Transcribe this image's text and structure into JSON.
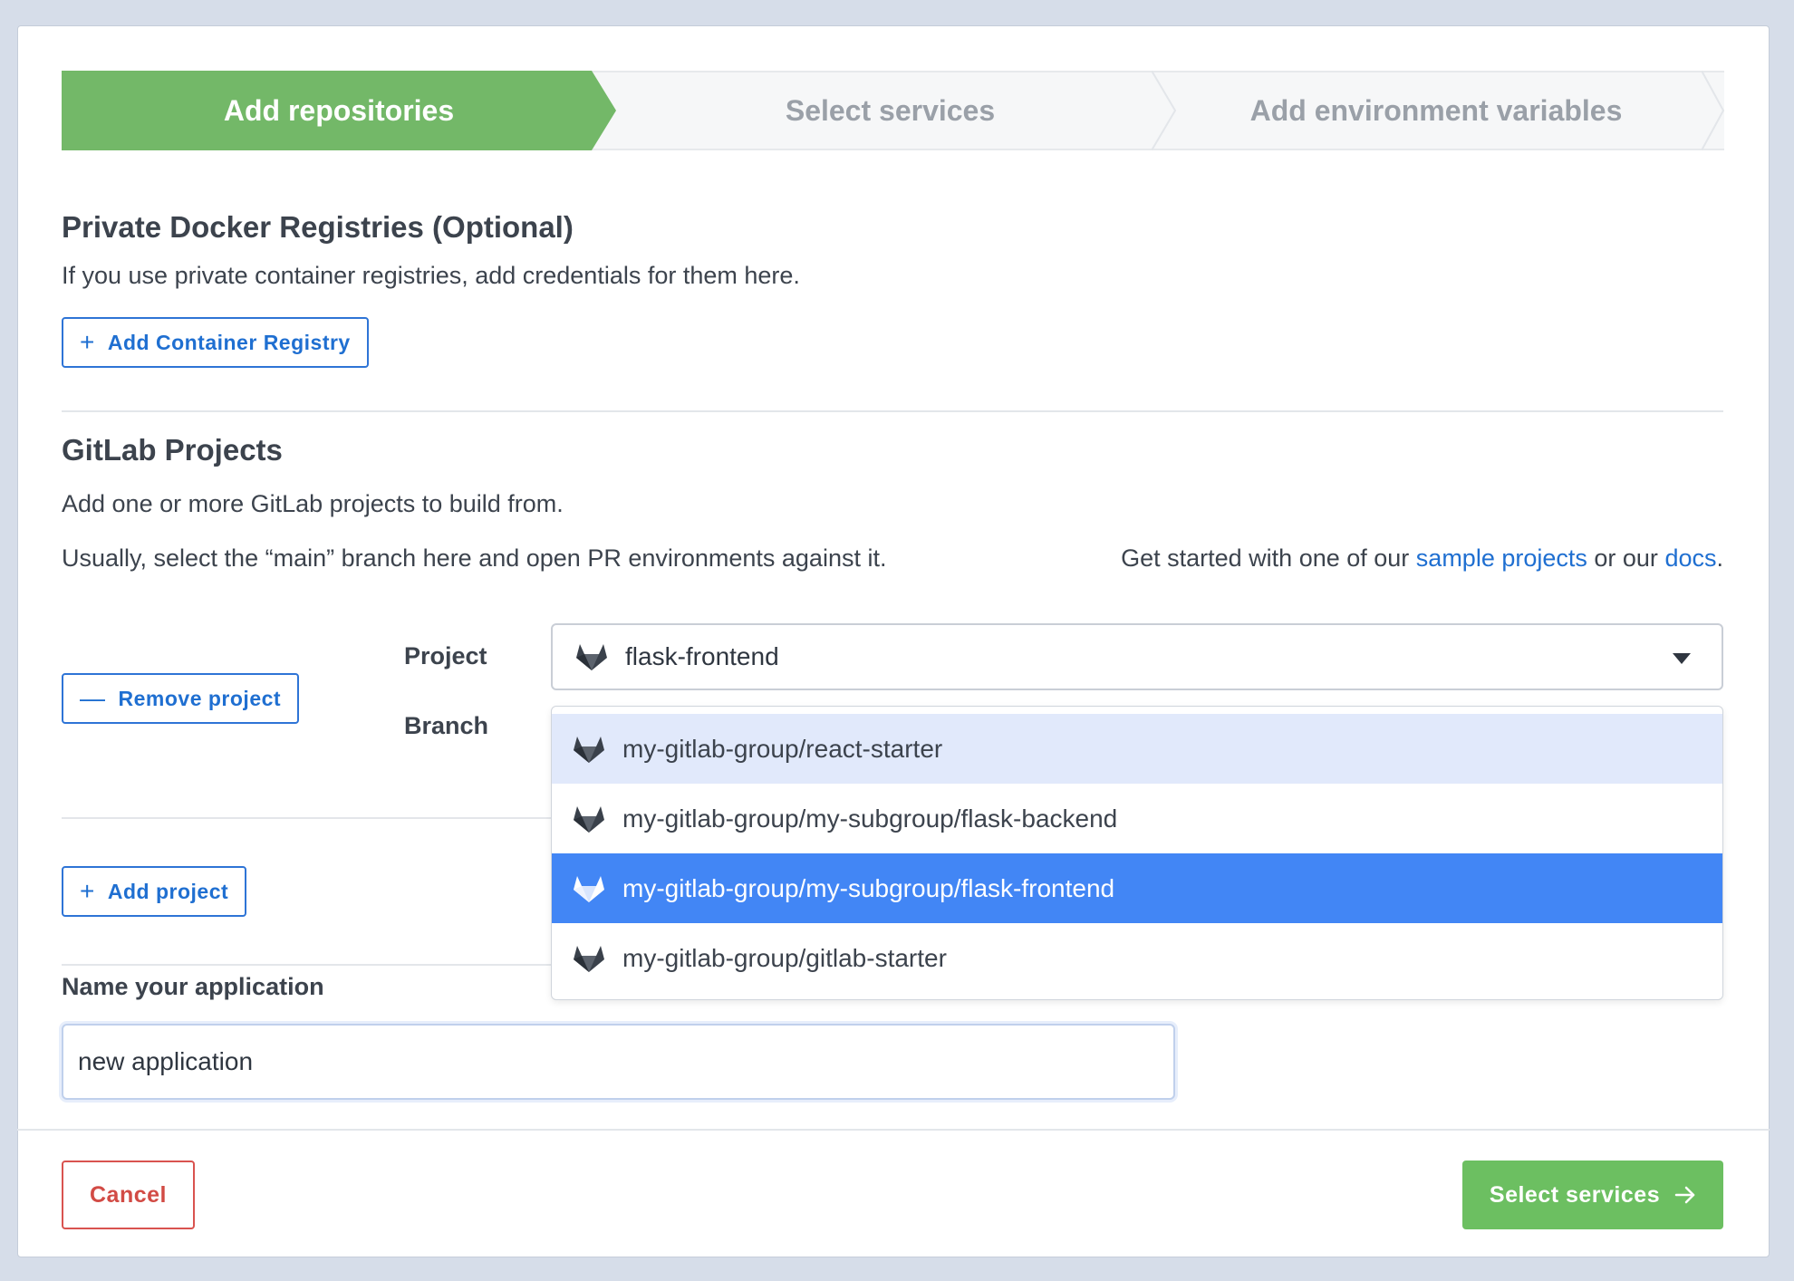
{
  "stepper": {
    "steps": [
      {
        "label": "Add repositories",
        "state": "active"
      },
      {
        "label": "Select services",
        "state": "inactive"
      },
      {
        "label": "Add environment variables",
        "state": "inactive"
      }
    ]
  },
  "registries": {
    "title": "Private Docker Registries (Optional)",
    "description": "If you use private container registries, add credentials for them here.",
    "add_button": "Add Container Registry"
  },
  "projects": {
    "title": "GitLab Projects",
    "description": "Add one or more GitLab projects to build from.",
    "hint": "Usually, select the “main” branch here and open PR environments against it.",
    "get_started_prefix": "Get started with one of our ",
    "sample_link": "sample projects",
    "get_started_middle": " or our ",
    "docs_link": "docs",
    "get_started_suffix": ".",
    "remove_button": "Remove project",
    "project_label": "Project",
    "branch_label": "Branch",
    "selected_project": "flask-frontend",
    "options": [
      "my-gitlab-group/react-starter",
      "my-gitlab-group/my-subgroup/flask-backend",
      "my-gitlab-group/my-subgroup/flask-frontend",
      "my-gitlab-group/gitlab-starter"
    ],
    "add_button": "Add project"
  },
  "app_name": {
    "label": "Name your application",
    "value": "new application"
  },
  "footer": {
    "cancel": "Cancel",
    "next": "Select services"
  },
  "colors": {
    "step_active": "#73b868",
    "link": "#1f6fd1",
    "option_active": "#4286f5",
    "option_hover": "#e1e9fb",
    "cancel": "#d24b45",
    "primary": "#6cbf61"
  }
}
